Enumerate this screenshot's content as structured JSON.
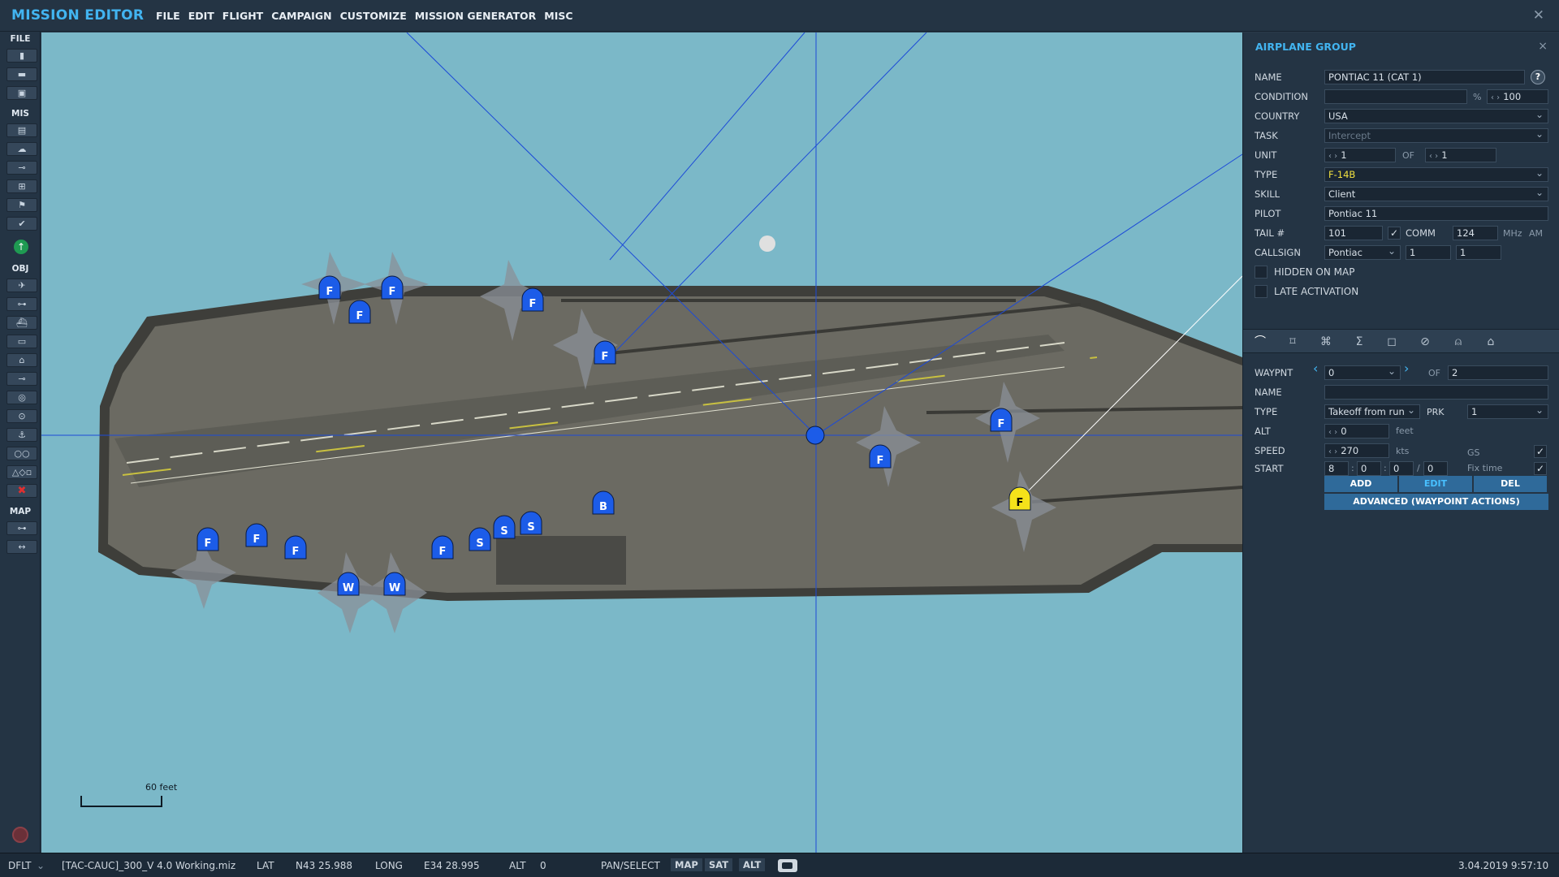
{
  "app": {
    "title": "MISSION EDITOR",
    "close_glyph": "✕"
  },
  "menu": [
    "FILE",
    "EDIT",
    "FLIGHT",
    "CAMPAIGN",
    "CUSTOMIZE",
    "MISSION GENERATOR",
    "MISC"
  ],
  "toolbar": {
    "sections": {
      "file": "FILE",
      "mis": "MIS",
      "obj": "OBJ",
      "map": "MAP"
    },
    "file_icons": [
      "new-file-icon",
      "open-folder-icon",
      "save-icon"
    ],
    "mis_icons": [
      "briefing-icon",
      "weather-icon",
      "triggers-icon",
      "resources-icon",
      "goals-icon",
      "check-icon"
    ],
    "obj_icons": [
      "airplane-icon",
      "helicopter-icon",
      "ship-icon",
      "ground-vehicle-icon",
      "static-object-icon",
      "waypoint-icon",
      "target-icon",
      "zone-icon",
      "carrier-icon",
      "template-icon",
      "shapes-icon",
      "delete-icon"
    ],
    "map_icons": [
      "ruler-icon",
      "distance-icon"
    ]
  },
  "map": {
    "scale_label": "60 feet",
    "markers": [
      {
        "letter": "F",
        "cls": "blue"
      },
      {
        "letter": "F",
        "cls": "blue"
      },
      {
        "letter": "F",
        "cls": "blue"
      },
      {
        "letter": "F",
        "cls": "blue"
      },
      {
        "letter": "F",
        "cls": "blue"
      },
      {
        "letter": "F",
        "cls": "blue"
      },
      {
        "letter": "F",
        "cls": "blue"
      },
      {
        "letter": "F",
        "cls": "blue"
      },
      {
        "letter": "F",
        "cls": "blue"
      },
      {
        "letter": "F",
        "cls": "blue"
      },
      {
        "letter": "F",
        "cls": "blue"
      },
      {
        "letter": "F",
        "cls": "selected"
      },
      {
        "letter": "W",
        "cls": "blue"
      },
      {
        "letter": "W",
        "cls": "blue"
      },
      {
        "letter": "B",
        "cls": "blue"
      },
      {
        "letter": "S",
        "cls": "blue"
      },
      {
        "letter": "S",
        "cls": "blue"
      },
      {
        "letter": "S",
        "cls": "blue"
      }
    ]
  },
  "panel": {
    "title": "AIRPLANE GROUP",
    "close_glyph": "×",
    "name_label": "NAME",
    "name_value": "PONTIAC 11 (CAT 1)",
    "help": "?",
    "condition_label": "CONDITION",
    "condition_value": "",
    "condition_unit": "%",
    "condition_pct": "100",
    "country_label": "COUNTRY",
    "country_value": "USA",
    "task_label": "TASK",
    "task_value": "Intercept",
    "unit_label": "UNIT",
    "unit_value": "1",
    "of_label": "OF",
    "of_value": "1",
    "type_label": "TYPE",
    "type_value": "F-14B",
    "skill_label": "SKILL",
    "skill_value": "Client",
    "pilot_label": "PILOT",
    "pilot_value": "Pontiac 11",
    "tail_label": "TAIL #",
    "tail_value": "101",
    "comm_label": "COMM",
    "comm_value": "124",
    "comm_unit": "MHz",
    "comm_band": "AM",
    "callsign_label": "CALLSIGN",
    "callsign_value": "Pontiac",
    "callsign_num1": "1",
    "callsign_num2": "1",
    "hidden_label": "HIDDEN ON MAP",
    "late_label": "LATE ACTIVATION",
    "tabs": [
      "route-icon",
      "payload-icon",
      "waypoint-actions-icon",
      "summary-icon",
      "triggered-actions-icon",
      "failures-icon",
      "radio-icon",
      "hangar-icon"
    ],
    "tab_glyphs": [
      "⌒",
      "⌑",
      "⌘",
      "Σ",
      "◻",
      "⊘",
      "⍝",
      "⌂"
    ],
    "wp_label": "WAYPNT",
    "wp_value": "0",
    "wp_of_label": "OF",
    "wp_of_value": "2",
    "wp_name_label": "NAME",
    "wp_name_value": "",
    "wp_type_label": "TYPE",
    "wp_type_value": "Takeoff from run",
    "prk_label": "PRK",
    "prk_value": "1",
    "alt_label": "ALT",
    "alt_value": "0",
    "alt_unit": "feet",
    "speed_label": "SPEED",
    "speed_value": "270",
    "speed_unit": "kts",
    "gs_label": "GS",
    "start_label": "START",
    "start_h": "8",
    "start_m": "0",
    "start_s": "0",
    "start_slash": "/",
    "start_d": "0",
    "fixtime_label": "Fix time",
    "add_btn": "ADD",
    "edit_btn": "EDIT",
    "del_btn": "DEL",
    "advanced_btn": "ADVANCED (WAYPOINT ACTIONS)"
  },
  "status": {
    "mode": "DFLT",
    "file": "[TAC-CAUC]_300_V 4.0 Working.miz",
    "lat_label": "LAT",
    "lat_value": "N43 25.988",
    "long_label": "LONG",
    "long_value": "E34 28.995",
    "alt_label": "ALT",
    "alt_value": "0",
    "pan_label": "PAN/SELECT",
    "map_btn": "MAP",
    "sat_btn": "SAT",
    "alt_btn": "ALT",
    "datetime": "3.04.2019 9:57:10"
  },
  "colors": {
    "accent": "#42b4f0",
    "water": "#7bb8c8",
    "deck": "#6b6a62",
    "marker_blue": "#1c5ce8",
    "marker_selected": "#f5e21a"
  }
}
